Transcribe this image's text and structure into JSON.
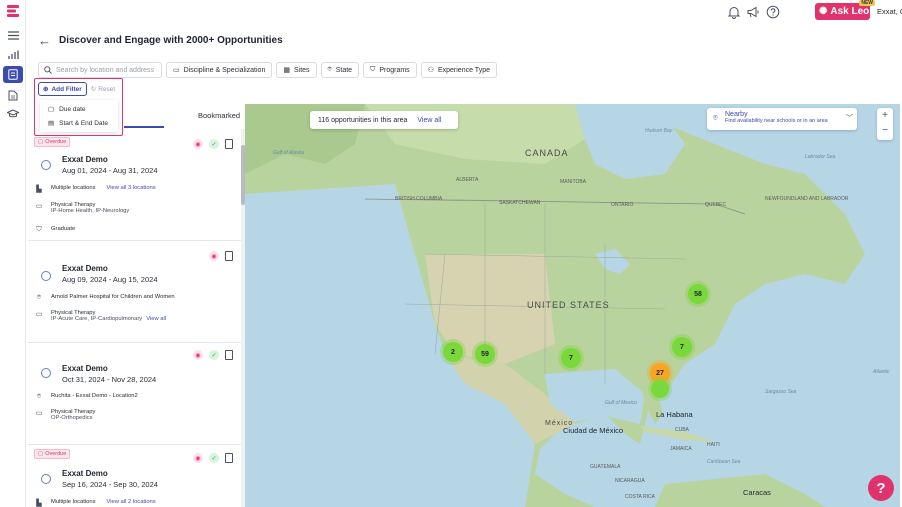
{
  "header": {
    "ask_leo": "Ask Leo",
    "ask_leo_badge": "NEW",
    "user": "Exxat, One"
  },
  "page": {
    "title": "Discover and Engage with 2000+ Opportunities"
  },
  "filters": {
    "search_placeholder": "Search by location and address",
    "chips": [
      "Discipline & Specialization",
      "Sites",
      "State",
      "Programs",
      "Experience Type"
    ],
    "add_filter": "Add Filter",
    "reset": "Reset",
    "dropdown": [
      "Due date",
      "Start & End Date"
    ]
  },
  "tabs": {
    "bookmarked": "Bookmarked"
  },
  "cards": [
    {
      "overdue": "Overdue",
      "org": "Exxat Demo",
      "dates": "Aug 01, 2024 - Aug 31, 2024",
      "location": "Multiple locations",
      "location_link": "View all 3 locations",
      "discipline": "Physical Therapy",
      "specialization": "IP-Home Health, IP-Neurology",
      "level": "Graduate"
    },
    {
      "org": "Exxat Demo",
      "dates": "Aug 09, 2024 - Aug 15, 2024",
      "location": "Arnold Palmer Hospital for Children and Women",
      "discipline": "Physical Therapy",
      "specialization": "IP-Acute Care, IP-Cardiopulmonary",
      "specialization_link": "View all"
    },
    {
      "org": "Exxat Demo",
      "dates": "Oct 31, 2024 - Nov 28, 2024",
      "location": "Ruchita - Exxat Demo - Location2",
      "discipline": "Physical Therapy",
      "specialization": "OP-Orthopedics"
    },
    {
      "overdue": "Overdue",
      "org": "Exxat Demo",
      "dates": "Sep 16, 2024 - Sep 30, 2024",
      "location": "Multiple locations",
      "location_link": "View all 2 locations"
    }
  ],
  "map": {
    "count_text": "116 opportunities in this area",
    "view_all": "View all",
    "nearby_title": "Nearby",
    "nearby_sub": "Find availability near schools or in an area",
    "labels": {
      "canada": "CANADA",
      "united_states": "UNITED STATES",
      "mexico": "México",
      "ciudad_de_mexico": "Ciudad de México",
      "la_habana": "La Habana",
      "caracas": "Caracas",
      "hudson_bay": "Hudson Bay",
      "gulf_alaska": "Gulf of Alaska",
      "labrador_sea": "Labrador Sea",
      "sargasso_sea": "Sargasso Sea",
      "caribbean_sea": "Caribbean Sea",
      "gulf_mexico": "Gulf of Mexico",
      "atlantic": "Atlantic",
      "alberta": "ALBERTA",
      "manitoba": "MANITOBA",
      "saskatchewan": "SASKATCHEWAN",
      "ontario": "ONTARIO",
      "quebec": "QUEBEC",
      "british_columbia": "BRITISH COLUMBIA",
      "newfoundland": "NEWFOUNDLAND AND LABRADOR",
      "cuba": "CUBA",
      "jamaica": "JAMAICA",
      "haiti": "HAITI",
      "guatemala": "GUATEMALA",
      "nicaragua": "NICARAGUA",
      "costa_rica": "COSTA RICA"
    },
    "clusters": [
      {
        "label": "58",
        "color": "green"
      },
      {
        "label": "2",
        "color": "green"
      },
      {
        "label": "59",
        "color": "green"
      },
      {
        "label": "7",
        "color": "green"
      },
      {
        "label": "7",
        "color": "green"
      },
      {
        "label": "27",
        "color": "orange"
      }
    ]
  },
  "colors": {
    "accent": "#3b4bb0",
    "brand": "#e0336c",
    "cluster_green": "#7ad83a",
    "cluster_orange": "#f6a623"
  }
}
